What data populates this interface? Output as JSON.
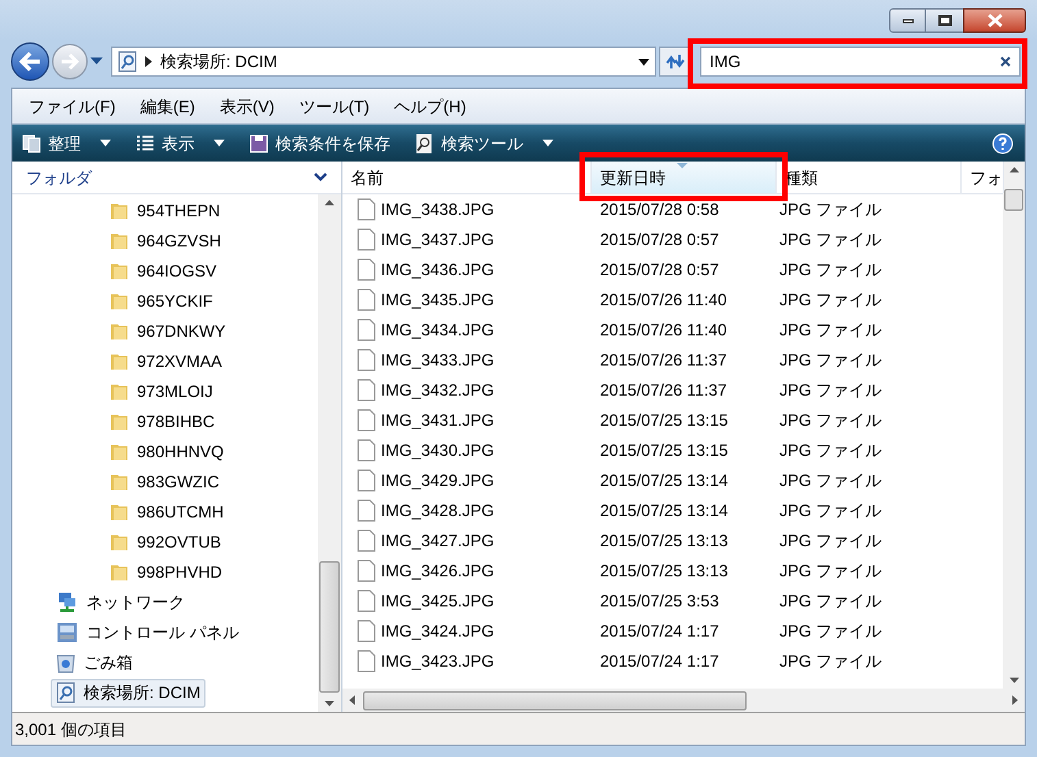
{
  "address": {
    "location": "検索場所: DCIM"
  },
  "search": {
    "value": "IMG"
  },
  "menu": [
    "ファイル(F)",
    "編集(E)",
    "表示(V)",
    "ツール(T)",
    "ヘルプ(H)"
  ],
  "toolbar": [
    {
      "label": "整理",
      "kind": "organize"
    },
    {
      "label": "表示",
      "kind": "views"
    },
    {
      "label": "検索条件を保存",
      "kind": "save"
    },
    {
      "label": "検索ツール",
      "kind": "searchtools"
    }
  ],
  "sidebar": {
    "header": "フォルダ",
    "folders": [
      "954THEPN",
      "964GZVSH",
      "964IOGSV",
      "965YCKIF",
      "967DNKWY",
      "972XVMAA",
      "973MLOIJ",
      "978BIHBC",
      "980HHNVQ",
      "983GWZIC",
      "986UTCMH",
      "992OVTUB",
      "998PHVHD"
    ],
    "items": [
      {
        "label": "ネットワーク",
        "kind": "network",
        "selected": false
      },
      {
        "label": "コントロール パネル",
        "kind": "control",
        "selected": false
      },
      {
        "label": "ごみ箱",
        "kind": "trash",
        "selected": false
      },
      {
        "label": "検索場所: DCIM",
        "kind": "search",
        "selected": true
      }
    ]
  },
  "columns": [
    {
      "label": "名前",
      "sorted": false
    },
    {
      "label": "更新日時",
      "sorted": true
    },
    {
      "label": "種類",
      "sorted": false
    },
    {
      "label": "フォ",
      "sorted": false
    }
  ],
  "rows": [
    {
      "name": "IMG_3438.JPG",
      "date": "2015/07/28 0:58",
      "type": "JPG ファイル"
    },
    {
      "name": "IMG_3437.JPG",
      "date": "2015/07/28 0:57",
      "type": "JPG ファイル"
    },
    {
      "name": "IMG_3436.JPG",
      "date": "2015/07/28 0:57",
      "type": "JPG ファイル"
    },
    {
      "name": "IMG_3435.JPG",
      "date": "2015/07/26 11:40",
      "type": "JPG ファイル"
    },
    {
      "name": "IMG_3434.JPG",
      "date": "2015/07/26 11:40",
      "type": "JPG ファイル"
    },
    {
      "name": "IMG_3433.JPG",
      "date": "2015/07/26 11:37",
      "type": "JPG ファイル"
    },
    {
      "name": "IMG_3432.JPG",
      "date": "2015/07/26 11:37",
      "type": "JPG ファイル"
    },
    {
      "name": "IMG_3431.JPG",
      "date": "2015/07/25 13:15",
      "type": "JPG ファイル"
    },
    {
      "name": "IMG_3430.JPG",
      "date": "2015/07/25 13:15",
      "type": "JPG ファイル"
    },
    {
      "name": "IMG_3429.JPG",
      "date": "2015/07/25 13:14",
      "type": "JPG ファイル"
    },
    {
      "name": "IMG_3428.JPG",
      "date": "2015/07/25 13:14",
      "type": "JPG ファイル"
    },
    {
      "name": "IMG_3427.JPG",
      "date": "2015/07/25 13:13",
      "type": "JPG ファイル"
    },
    {
      "name": "IMG_3426.JPG",
      "date": "2015/07/25 13:13",
      "type": "JPG ファイル"
    },
    {
      "name": "IMG_3425.JPG",
      "date": "2015/07/25 3:53",
      "type": "JPG ファイル"
    },
    {
      "name": "IMG_3424.JPG",
      "date": "2015/07/24 1:17",
      "type": "JPG ファイル"
    },
    {
      "name": "IMG_3423.JPG",
      "date": "2015/07/24 1:17",
      "type": "JPG ファイル"
    }
  ],
  "status": "3,001 個の項目"
}
